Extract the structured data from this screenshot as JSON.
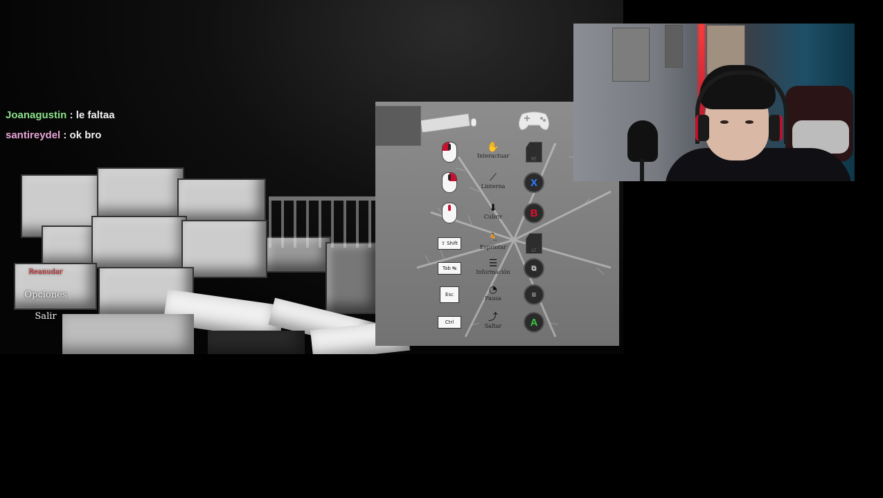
{
  "chat": {
    "messages": [
      {
        "user": "Joanagustin",
        "text": " : le faltaa"
      },
      {
        "user": "santireydel",
        "text": " : ok bro"
      }
    ]
  },
  "pause_menu": {
    "items": [
      {
        "label": "Reanudar",
        "active": true
      },
      {
        "label": "Opciones",
        "active": false
      },
      {
        "label": "Salir",
        "active": false
      }
    ]
  },
  "controls_panel": {
    "rows": [
      {
        "keyboard": "mouse-left-click",
        "action": "Interactuar",
        "action_icon": "hand-icon",
        "gamepad": "RT"
      },
      {
        "keyboard": "mouse-right-click",
        "action": "Linterna",
        "action_icon": "flashlight-icon",
        "gamepad": "X"
      },
      {
        "keyboard": "mouse-wheel",
        "action": "Cubrir",
        "action_icon": "arrow-down-icon",
        "gamepad": "B"
      },
      {
        "keyboard": "⇧ Shift",
        "action": "Esprintar",
        "action_icon": "running-icon",
        "gamepad": "LT"
      },
      {
        "keyboard": "Tab ↹",
        "action": "Información",
        "action_icon": "list-icon",
        "gamepad": "back"
      },
      {
        "keyboard": "Esc",
        "action": "Pausa",
        "action_icon": "clock-icon",
        "gamepad": "menu"
      },
      {
        "keyboard": "Ctrl",
        "action": "Saltar",
        "action_icon": "jump-icon",
        "gamepad": "A"
      }
    ]
  },
  "colors": {
    "menu_active": "#d51a1a",
    "chat_user_1": "#8be28b",
    "chat_user_2": "#e6a4d6",
    "pad_x": "#2f7fff",
    "pad_b": "#e0102a",
    "pad_a": "#39c641"
  }
}
